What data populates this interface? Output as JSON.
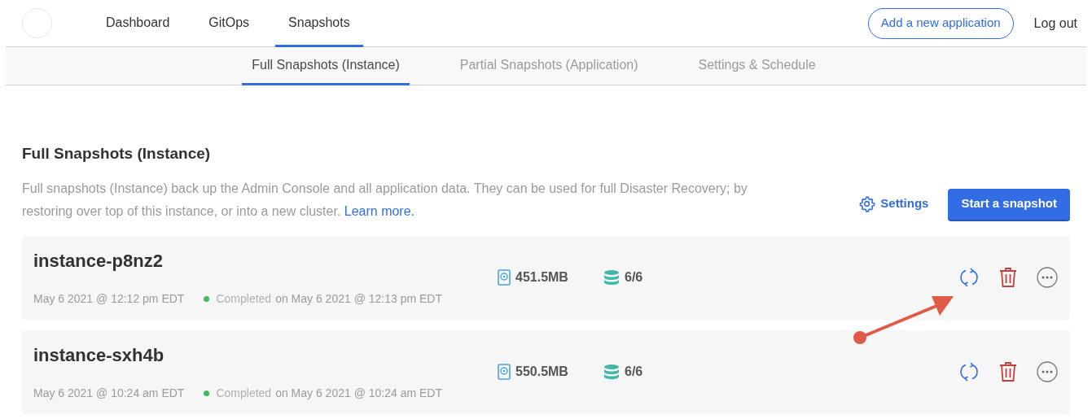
{
  "nav": {
    "items": [
      {
        "label": "Dashboard",
        "selected": false
      },
      {
        "label": "GitOps",
        "selected": false
      },
      {
        "label": "Snapshots",
        "selected": true
      }
    ],
    "add_button": "Add a new application",
    "logout": "Log out"
  },
  "subtabs": [
    {
      "label": "Full Snapshots (Instance)",
      "selected": true
    },
    {
      "label": "Partial Snapshots (Application)",
      "selected": false
    },
    {
      "label": "Settings & Schedule",
      "selected": false
    }
  ],
  "section": {
    "title": "Full Snapshots (Instance)",
    "description": "Full snapshots (Instance) back up the Admin Console and all application data. They can be used for full Disaster Recovery; by restoring over top of this instance, or into a new cluster.",
    "link": "Learn more.",
    "settings_link": "Settings",
    "start_button": "Start a snapshot"
  },
  "snapshots": [
    {
      "name": "instance-p8nz2",
      "started": "May 6 2021 @ 12:12 pm EDT",
      "status": "Completed",
      "color": "#44b863",
      "finished": "on May 6 2021 @ 12:13 pm EDT",
      "size": "451.5MB",
      "volumes": "6/6"
    },
    {
      "name": "instance-sxh4b",
      "started": "May 6 2021 @ 10:24 am EDT",
      "status": "Completed",
      "color": "#44b863",
      "finished": "on May 6 2021 @ 10:24 am EDT",
      "size": "550.5MB",
      "volumes": "6/6"
    }
  ]
}
